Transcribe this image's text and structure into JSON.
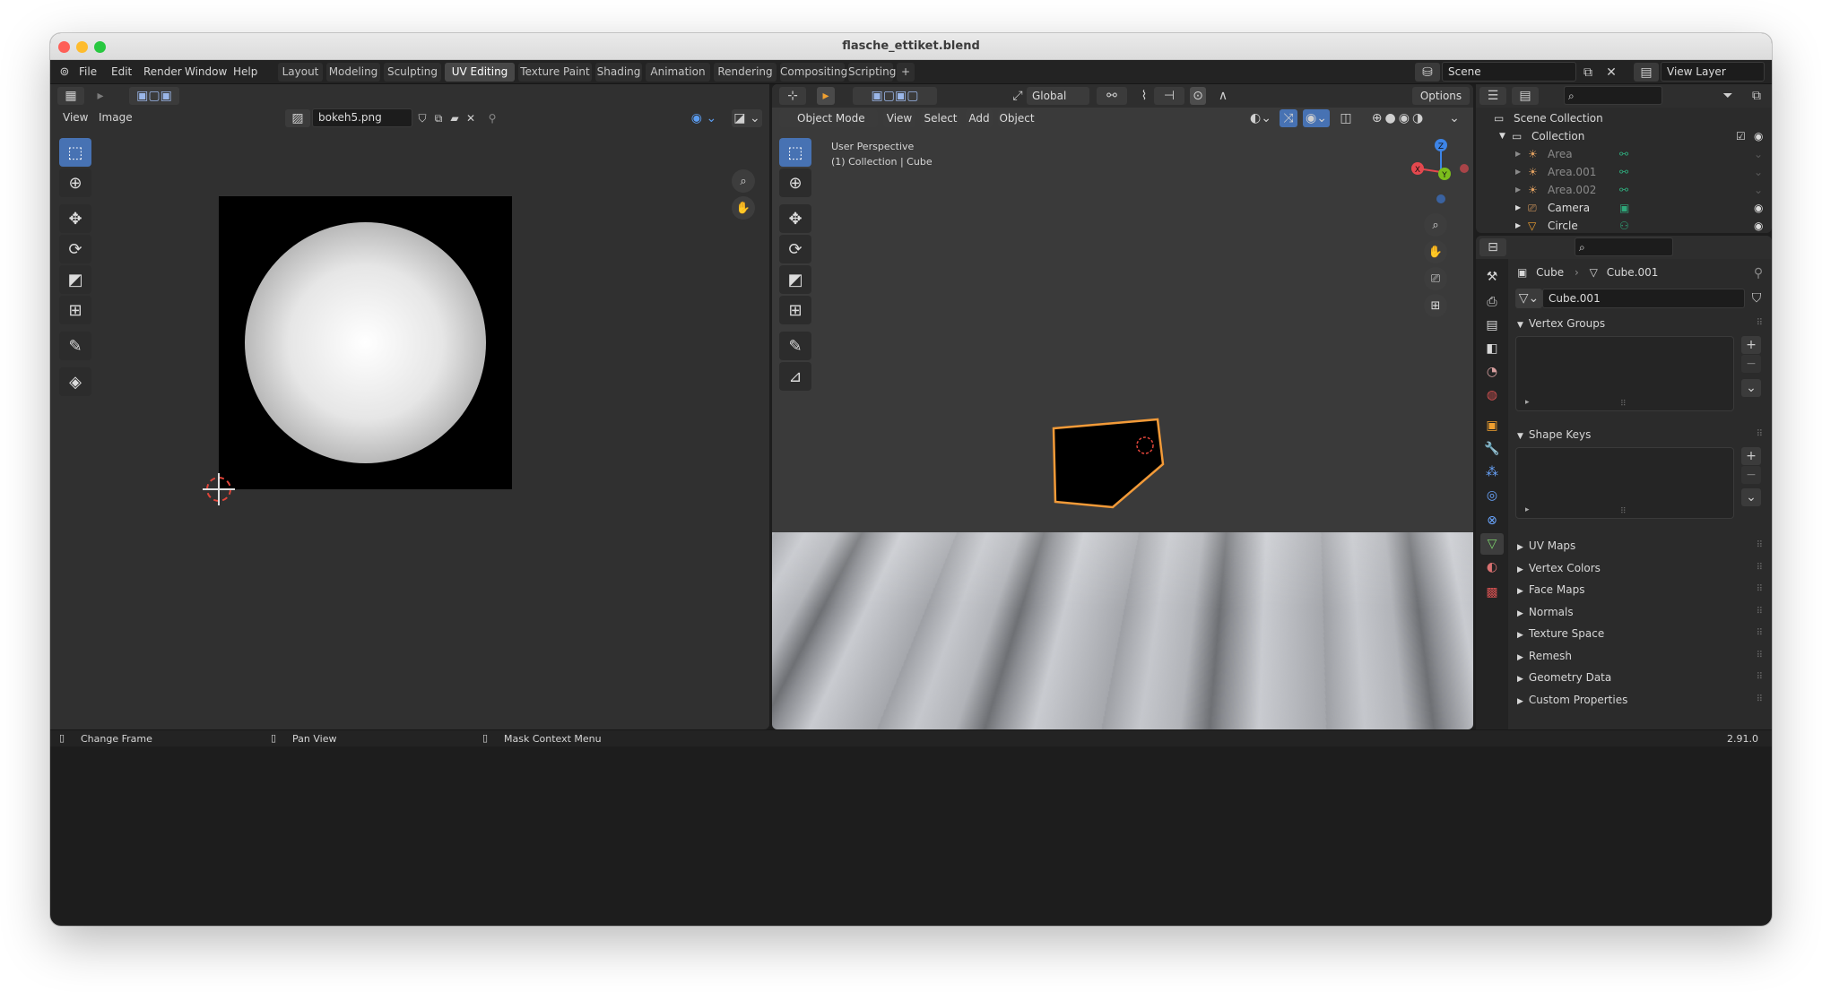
{
  "window": {
    "title": "flasche_ettiket.blend"
  },
  "menu": [
    "File",
    "Edit",
    "Render",
    "Window",
    "Help"
  ],
  "workspaces": [
    {
      "label": "Layout",
      "active": false
    },
    {
      "label": "Modeling",
      "active": false
    },
    {
      "label": "Sculpting",
      "active": false
    },
    {
      "label": "UV Editing",
      "active": true
    },
    {
      "label": "Texture Paint",
      "active": false
    },
    {
      "label": "Shading",
      "active": false
    },
    {
      "label": "Animation",
      "active": false
    },
    {
      "label": "Rendering",
      "active": false
    },
    {
      "label": "Compositing",
      "active": false
    },
    {
      "label": "Scripting",
      "active": false
    }
  ],
  "add_workspace": "+",
  "scene": {
    "name": "Scene",
    "view_layer": "View Layer"
  },
  "uv_editor": {
    "menus": [
      "View",
      "Image"
    ],
    "image_name": "bokeh5.png"
  },
  "viewport": {
    "mode": "Object Mode",
    "menus": [
      "View",
      "Select",
      "Add",
      "Object"
    ],
    "orientation": "Global",
    "options": "Options",
    "overlay_line1": "User Perspective",
    "overlay_line2": "(1) Collection | Cube",
    "gizmo": {
      "x": "X",
      "y": "Y",
      "z": "Z"
    }
  },
  "outliner": {
    "root": "Scene Collection",
    "collection": "Collection",
    "items": [
      {
        "name": "Area",
        "type": "light",
        "dim": true
      },
      {
        "name": "Area.001",
        "type": "light",
        "dim": true
      },
      {
        "name": "Area.002",
        "type": "light",
        "dim": true
      },
      {
        "name": "Camera",
        "type": "camera",
        "dim": false
      },
      {
        "name": "Circle",
        "type": "mesh",
        "dim": false
      }
    ]
  },
  "properties": {
    "breadcrumb_object": "Cube",
    "breadcrumb_data": "Cube.001",
    "mesh_name": "Cube.001",
    "panels_open": [
      "Vertex Groups",
      "Shape Keys"
    ],
    "panels_closed": [
      "UV Maps",
      "Vertex Colors",
      "Face Maps",
      "Normals",
      "Texture Space",
      "Remesh",
      "Geometry Data",
      "Custom Properties"
    ]
  },
  "status": {
    "left": "Change Frame",
    "middle": "Pan View",
    "right": "Mask Context Menu",
    "version": "2.91.0"
  },
  "colors": {
    "accent": "#4772b3",
    "selection_outline": "#f29a38",
    "axis_x": "#e4484e",
    "axis_y": "#7cbe1c",
    "axis_z": "#3d84e6"
  },
  "icons": [
    "search-icon",
    "zoom-icon",
    "hand-icon",
    "camera-icon",
    "grid-icon",
    "eye-icon",
    "cursor-icon",
    "move-icon",
    "rotate-icon",
    "scale-icon",
    "transform-icon",
    "annotate-icon",
    "measure-icon",
    "pin-icon",
    "filter-icon",
    "shield-icon"
  ]
}
